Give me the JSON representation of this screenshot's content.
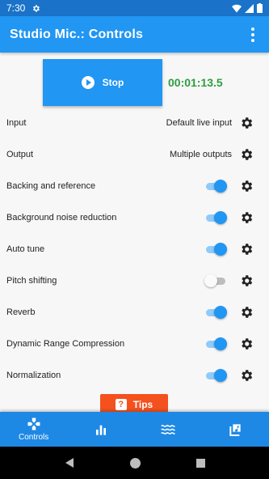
{
  "status_bar": {
    "time": "7:30"
  },
  "app_bar": {
    "title": "Studio Mic.: Controls"
  },
  "record": {
    "button_label": "Stop",
    "timer": "00:01:13.5"
  },
  "controls": [
    {
      "label": "Input",
      "type": "value",
      "value": "Default live input"
    },
    {
      "label": "Output",
      "type": "value",
      "value": "Multiple outputs"
    },
    {
      "label": "Backing and reference",
      "type": "toggle",
      "on": true
    },
    {
      "label": "Background noise reduction",
      "type": "toggle",
      "on": true
    },
    {
      "label": "Auto tune",
      "type": "toggle",
      "on": true
    },
    {
      "label": "Pitch shifting",
      "type": "toggle",
      "on": false
    },
    {
      "label": "Reverb",
      "type": "toggle",
      "on": true
    },
    {
      "label": "Dynamic Range Compression",
      "type": "toggle",
      "on": true
    },
    {
      "label": "Normalization",
      "type": "toggle",
      "on": true
    }
  ],
  "tips": {
    "label": "Tips",
    "icon_text": "?"
  },
  "bottom_nav": [
    {
      "icon": "gamepad-icon",
      "label": "Controls",
      "active": true
    },
    {
      "icon": "bar-chart-icon",
      "label": ""
    },
    {
      "icon": "waves-icon",
      "label": ""
    },
    {
      "icon": "music-library-icon",
      "label": ""
    }
  ],
  "colors": {
    "primary": "#2196f3",
    "status_bar": "#1a73c9",
    "timer": "#2e9e3f",
    "tips": "#f4511e",
    "toggle_on_thumb": "#2196f3",
    "toggle_on_track": "#90caf9"
  }
}
